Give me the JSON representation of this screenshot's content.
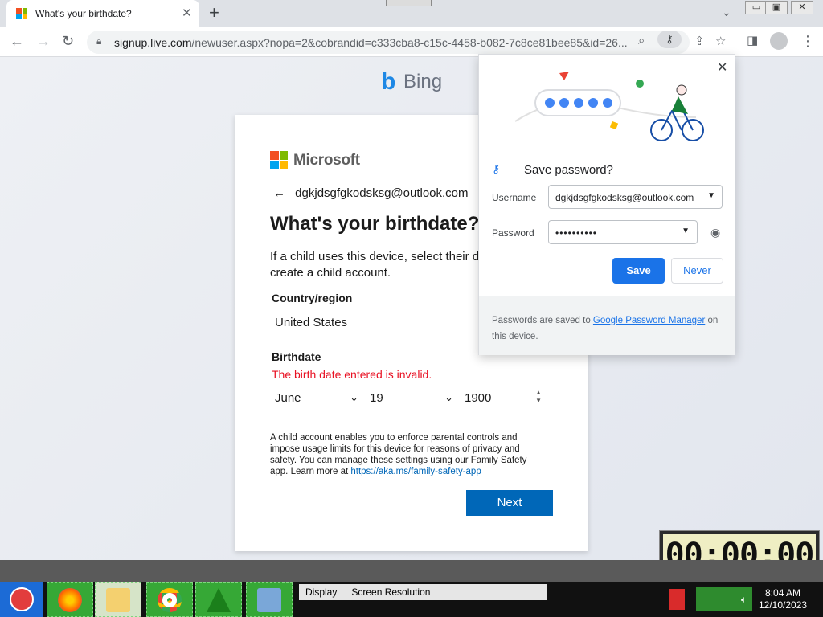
{
  "browser": {
    "tab_title": "What's your birthdate?",
    "tab_close": "✕",
    "new_tab": "+",
    "url_host": "signup.live.com",
    "url_path": "/newuser.aspx?nopa=2&cobrandid=c333cba8-c15c-4458-b082-7c8ce81bee85&id=26...",
    "window_buttons": [
      "▭",
      "▣",
      "✕"
    ]
  },
  "page": {
    "bing_text": "Bing",
    "ms_text": "Microsoft",
    "back_arrow": "←",
    "email": "dgkjdsgfgkodsksg@outlook.com",
    "heading": "What's your birthdate?",
    "description": "If a child uses this device, select their date of birth to create a child account.",
    "country_label": "Country/region",
    "country_value": "United States",
    "birthdate_label": "Birthdate",
    "error": "The birth date entered is invalid.",
    "month": "June",
    "day": "19",
    "year": "1900",
    "info_text": "A child account enables you to enforce parental controls and impose usage limits for this device for reasons of privacy and safety. You can manage these settings using our Family Safety app. Learn more at ",
    "info_link": "https://aka.ms/family-safety-app",
    "next_label": "Next"
  },
  "password_bubble": {
    "title": "Save password?",
    "username_label": "Username",
    "username_value": "dgkjdsgfgkodsksg@outlook.com",
    "password_label": "Password",
    "password_value": "••••••••••",
    "save_label": "Save",
    "never_label": "Never",
    "footer_pre": "Passwords are saved to ",
    "footer_link": "Google Password Manager",
    "footer_post": " on this device."
  },
  "taskbar": {
    "window_items": [
      "Display",
      "Screen Resolution"
    ],
    "time": "8:04 AM",
    "date": "12/10/2023",
    "timer": "00:00:00"
  },
  "colors": {
    "ms_red": "#f25022",
    "ms_green": "#7fba00",
    "ms_blue": "#00a4ef",
    "ms_yellow": "#ffb900",
    "ms_accent": "#0067b8",
    "chrome_blue": "#1a73e8",
    "error": "#e81123"
  }
}
